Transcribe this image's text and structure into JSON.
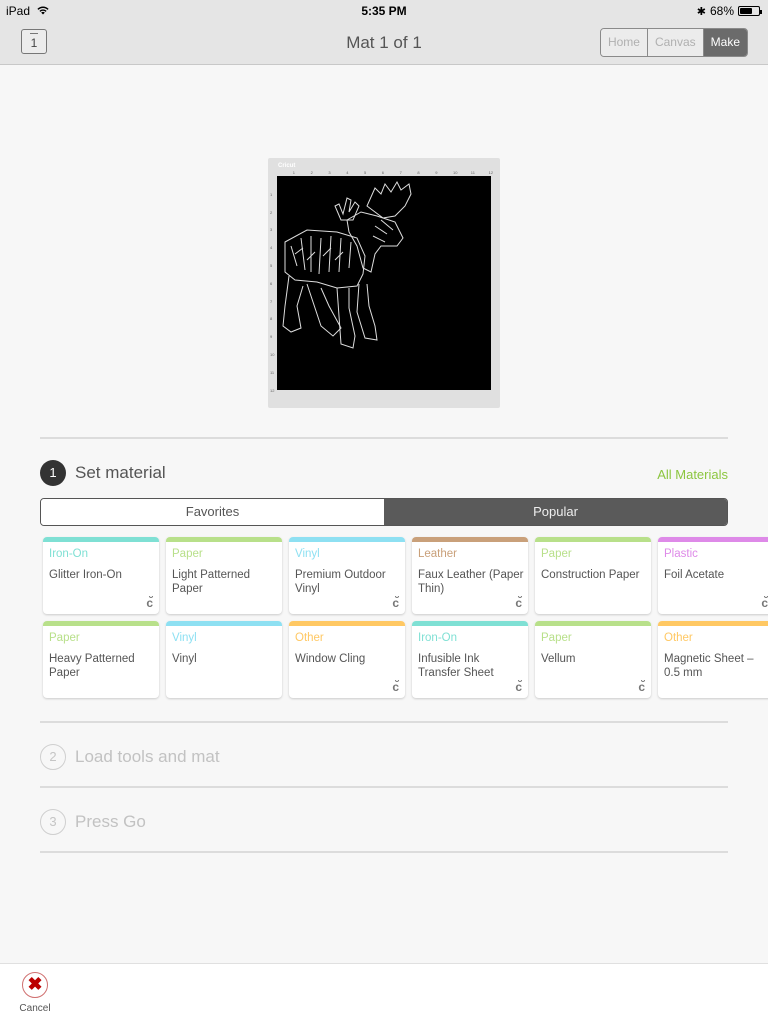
{
  "status_bar": {
    "device": "iPad",
    "time": "5:35 PM",
    "battery_percent": "68%",
    "battery_level": 0.68
  },
  "nav": {
    "mat_icon_number": "1",
    "title": "Mat 1 of 1",
    "segments": [
      {
        "label": "Home",
        "active": false
      },
      {
        "label": "Canvas",
        "active": false
      },
      {
        "label": "Make",
        "active": true
      }
    ]
  },
  "mat_preview": {
    "brand": "Cricut",
    "ruler_top": [
      "1",
      "2",
      "3",
      "4",
      "5",
      "6",
      "7",
      "8",
      "9",
      "10",
      "11",
      "12"
    ],
    "ruler_left": [
      "1",
      "2",
      "3",
      "4",
      "5",
      "6",
      "7",
      "8",
      "9",
      "10",
      "11",
      "12"
    ]
  },
  "steps": [
    {
      "number": "1",
      "title": "Set material",
      "active": true
    },
    {
      "number": "2",
      "title": "Load tools and mat",
      "active": false
    },
    {
      "number": "3",
      "title": "Press Go",
      "active": false
    }
  ],
  "all_materials_label": "All Materials",
  "tabs": [
    {
      "label": "Favorites",
      "selected": false
    },
    {
      "label": "Popular",
      "selected": true
    }
  ],
  "category_colors": {
    "Iron-On": "#7fe0d4",
    "Paper": "#b8e08a",
    "Vinyl": "#8ee0f2",
    "Leather": "#c9a07a",
    "Plastic": "#de8ae8",
    "Other": "#ffc863"
  },
  "materials": [
    {
      "category": "Iron-On",
      "name": "Glitter Iron-On",
      "cricut_icon": true
    },
    {
      "category": "Paper",
      "name": "Light Patterned Paper",
      "cricut_icon": false
    },
    {
      "category": "Vinyl",
      "name": "Premium Outdoor Vinyl",
      "cricut_icon": true
    },
    {
      "category": "Leather",
      "name": "Faux Leather (Paper Thin)",
      "cricut_icon": true
    },
    {
      "category": "Paper",
      "name": "Construction Paper",
      "cricut_icon": false
    },
    {
      "category": "Plastic",
      "name": "Foil Acetate",
      "cricut_icon": true
    },
    {
      "category": "Paper",
      "name": "Heavy Patterned Paper",
      "cricut_icon": false
    },
    {
      "category": "Vinyl",
      "name": "Vinyl",
      "cricut_icon": false
    },
    {
      "category": "Other",
      "name": "Window Cling",
      "cricut_icon": true
    },
    {
      "category": "Iron-On",
      "name": "Infusible Ink Transfer Sheet",
      "cricut_icon": true
    },
    {
      "category": "Paper",
      "name": "Vellum",
      "cricut_icon": true
    },
    {
      "category": "Other",
      "name": "Magnetic Sheet – 0.5 mm",
      "cricut_icon": false
    }
  ],
  "bottom_bar": {
    "cancel_label": "Cancel"
  }
}
